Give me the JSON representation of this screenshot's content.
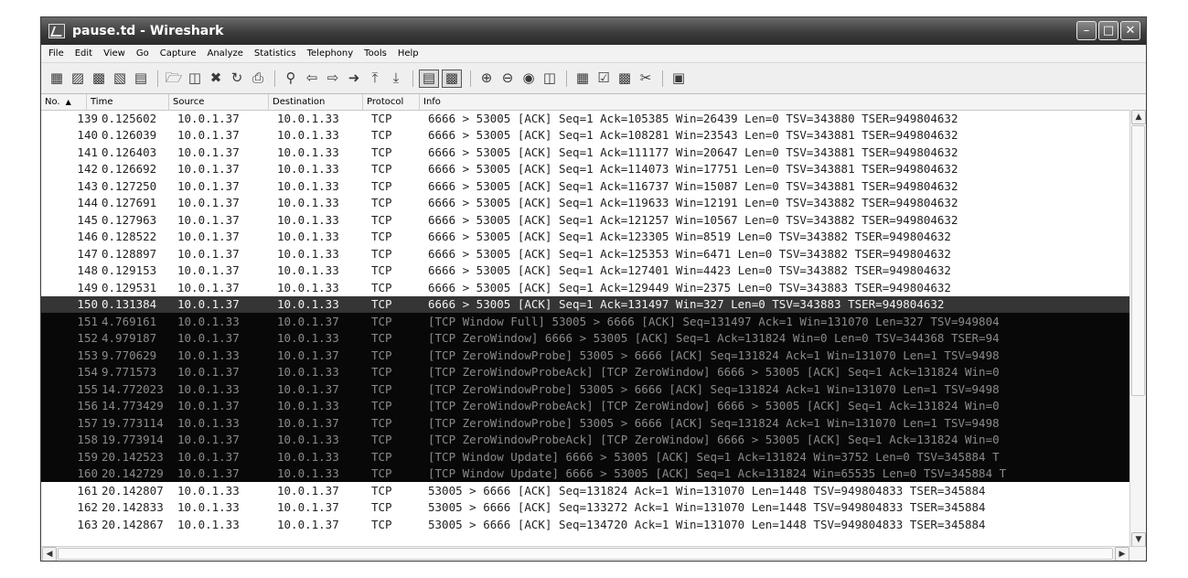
{
  "window": {
    "title": "pause.td - Wireshark"
  },
  "menu": [
    "File",
    "Edit",
    "View",
    "Go",
    "Capture",
    "Analyze",
    "Statistics",
    "Telephony",
    "Tools",
    "Help"
  ],
  "columns": {
    "no": "No.",
    "time": "Time",
    "source": "Source",
    "destination": "Destination",
    "protocol": "Protocol",
    "info": "Info"
  },
  "packets": [
    {
      "no": "139",
      "time": "0.125602",
      "src": "10.0.1.37",
      "dst": "10.0.1.33",
      "proto": "TCP",
      "info": "6666 > 53005 [ACK] Seq=1 Ack=105385 Win=26439 Len=0 TSV=343880 TSER=949804632"
    },
    {
      "no": "140",
      "time": "0.126039",
      "src": "10.0.1.37",
      "dst": "10.0.1.33",
      "proto": "TCP",
      "info": "6666 > 53005 [ACK] Seq=1 Ack=108281 Win=23543 Len=0 TSV=343881 TSER=949804632"
    },
    {
      "no": "141",
      "time": "0.126403",
      "src": "10.0.1.37",
      "dst": "10.0.1.33",
      "proto": "TCP",
      "info": "6666 > 53005 [ACK] Seq=1 Ack=111177 Win=20647 Len=0 TSV=343881 TSER=949804632"
    },
    {
      "no": "142",
      "time": "0.126692",
      "src": "10.0.1.37",
      "dst": "10.0.1.33",
      "proto": "TCP",
      "info": "6666 > 53005 [ACK] Seq=1 Ack=114073 Win=17751 Len=0 TSV=343881 TSER=949804632"
    },
    {
      "no": "143",
      "time": "0.127250",
      "src": "10.0.1.37",
      "dst": "10.0.1.33",
      "proto": "TCP",
      "info": "6666 > 53005 [ACK] Seq=1 Ack=116737 Win=15087 Len=0 TSV=343881 TSER=949804632"
    },
    {
      "no": "144",
      "time": "0.127691",
      "src": "10.0.1.37",
      "dst": "10.0.1.33",
      "proto": "TCP",
      "info": "6666 > 53005 [ACK] Seq=1 Ack=119633 Win=12191 Len=0 TSV=343882 TSER=949804632"
    },
    {
      "no": "145",
      "time": "0.127963",
      "src": "10.0.1.37",
      "dst": "10.0.1.33",
      "proto": "TCP",
      "info": "6666 > 53005 [ACK] Seq=1 Ack=121257 Win=10567 Len=0 TSV=343882 TSER=949804632"
    },
    {
      "no": "146",
      "time": "0.128522",
      "src": "10.0.1.37",
      "dst": "10.0.1.33",
      "proto": "TCP",
      "info": "6666 > 53005 [ACK] Seq=1 Ack=123305 Win=8519 Len=0 TSV=343882 TSER=949804632"
    },
    {
      "no": "147",
      "time": "0.128897",
      "src": "10.0.1.37",
      "dst": "10.0.1.33",
      "proto": "TCP",
      "info": "6666 > 53005 [ACK] Seq=1 Ack=125353 Win=6471 Len=0 TSV=343882 TSER=949804632"
    },
    {
      "no": "148",
      "time": "0.129153",
      "src": "10.0.1.37",
      "dst": "10.0.1.33",
      "proto": "TCP",
      "info": "6666 > 53005 [ACK] Seq=1 Ack=127401 Win=4423 Len=0 TSV=343882 TSER=949804632"
    },
    {
      "no": "149",
      "time": "0.129531",
      "src": "10.0.1.37",
      "dst": "10.0.1.33",
      "proto": "TCP",
      "info": "6666 > 53005 [ACK] Seq=1 Ack=129449 Win=2375 Len=0 TSV=343883 TSER=949804632"
    },
    {
      "no": "150",
      "time": "0.131384",
      "src": "10.0.1.37",
      "dst": "10.0.1.33",
      "proto": "TCP",
      "info": "6666 > 53005 [ACK] Seq=1 Ack=131497 Win=327 Len=0 TSV=343883 TSER=949804632",
      "selected": true
    },
    {
      "no": "151",
      "time": "4.769161",
      "src": "10.0.1.33",
      "dst": "10.0.1.37",
      "proto": "TCP",
      "info": "[TCP Window Full] 53005 > 6666 [ACK] Seq=131497 Ack=1 Win=131070 Len=327 TSV=949804",
      "dark": true
    },
    {
      "no": "152",
      "time": "4.979187",
      "src": "10.0.1.37",
      "dst": "10.0.1.33",
      "proto": "TCP",
      "info": "[TCP ZeroWindow] 6666 > 53005 [ACK] Seq=1 Ack=131824 Win=0 Len=0 TSV=344368 TSER=94",
      "dark": true
    },
    {
      "no": "153",
      "time": "9.770629",
      "src": "10.0.1.33",
      "dst": "10.0.1.37",
      "proto": "TCP",
      "info": "[TCP ZeroWindowProbe] 53005 > 6666 [ACK] Seq=131824 Ack=1 Win=131070 Len=1 TSV=9498",
      "dark": true
    },
    {
      "no": "154",
      "time": "9.771573",
      "src": "10.0.1.37",
      "dst": "10.0.1.33",
      "proto": "TCP",
      "info": "[TCP ZeroWindowProbeAck] [TCP ZeroWindow] 6666 > 53005 [ACK] Seq=1 Ack=131824 Win=0",
      "dark": true
    },
    {
      "no": "155",
      "time": "14.772023",
      "src": "10.0.1.33",
      "dst": "10.0.1.37",
      "proto": "TCP",
      "info": "[TCP ZeroWindowProbe] 53005 > 6666 [ACK] Seq=131824 Ack=1 Win=131070 Len=1 TSV=9498",
      "dark": true
    },
    {
      "no": "156",
      "time": "14.773429",
      "src": "10.0.1.37",
      "dst": "10.0.1.33",
      "proto": "TCP",
      "info": "[TCP ZeroWindowProbeAck] [TCP ZeroWindow] 6666 > 53005 [ACK] Seq=1 Ack=131824 Win=0",
      "dark": true
    },
    {
      "no": "157",
      "time": "19.773114",
      "src": "10.0.1.33",
      "dst": "10.0.1.37",
      "proto": "TCP",
      "info": "[TCP ZeroWindowProbe] 53005 > 6666 [ACK] Seq=131824 Ack=1 Win=131070 Len=1 TSV=9498",
      "dark": true
    },
    {
      "no": "158",
      "time": "19.773914",
      "src": "10.0.1.37",
      "dst": "10.0.1.33",
      "proto": "TCP",
      "info": "[TCP ZeroWindowProbeAck] [TCP ZeroWindow] 6666 > 53005 [ACK] Seq=1 Ack=131824 Win=0",
      "dark": true
    },
    {
      "no": "159",
      "time": "20.142523",
      "src": "10.0.1.37",
      "dst": "10.0.1.33",
      "proto": "TCP",
      "info": "[TCP Window Update] 6666 > 53005 [ACK] Seq=1 Ack=131824 Win=3752 Len=0 TSV=345884 T",
      "dark": true
    },
    {
      "no": "160",
      "time": "20.142729",
      "src": "10.0.1.37",
      "dst": "10.0.1.33",
      "proto": "TCP",
      "info": "[TCP Window Update] 6666 > 53005 [ACK] Seq=1 Ack=131824 Win=65535 Len=0 TSV=345884 T",
      "dark": true
    },
    {
      "no": "161",
      "time": "20.142807",
      "src": "10.0.1.33",
      "dst": "10.0.1.37",
      "proto": "TCP",
      "info": "53005 > 6666 [ACK] Seq=131824 Ack=1 Win=131070 Len=1448 TSV=949804833 TSER=345884"
    },
    {
      "no": "162",
      "time": "20.142833",
      "src": "10.0.1.33",
      "dst": "10.0.1.37",
      "proto": "TCP",
      "info": "53005 > 6666 [ACK] Seq=133272 Ack=1 Win=131070 Len=1448 TSV=949804833 TSER=345884"
    },
    {
      "no": "163",
      "time": "20.142867",
      "src": "10.0.1.33",
      "dst": "10.0.1.37",
      "proto": "TCP",
      "info": "53005 > 6666 [ACK] Seq=134720 Ack=1 Win=131070 Len=1448 TSV=949804833 TSER=345884"
    }
  ],
  "toolbar_icons": [
    "interface-list-icon",
    "capture-options-icon",
    "start-capture-icon",
    "stop-capture-icon",
    "restart-capture-icon",
    "open-file-icon",
    "save-file-icon",
    "close-file-icon",
    "reload-icon",
    "print-icon",
    "find-packet-icon",
    "go-back-icon",
    "go-forward-icon",
    "go-to-packet-icon",
    "go-first-icon",
    "go-last-icon",
    "colorize-icon",
    "autoscroll-icon",
    "zoom-in-icon",
    "zoom-out-icon",
    "normal-size-icon",
    "resize-columns-icon",
    "capture-filters-icon",
    "display-filters-icon",
    "coloring-rules-icon",
    "preferences-icon",
    "help-icon"
  ],
  "colors": {
    "selected_row": "#353535",
    "marked_row": "#080808",
    "marked_text": "#8a8a8a",
    "titlebar": "#3d3d3d"
  }
}
